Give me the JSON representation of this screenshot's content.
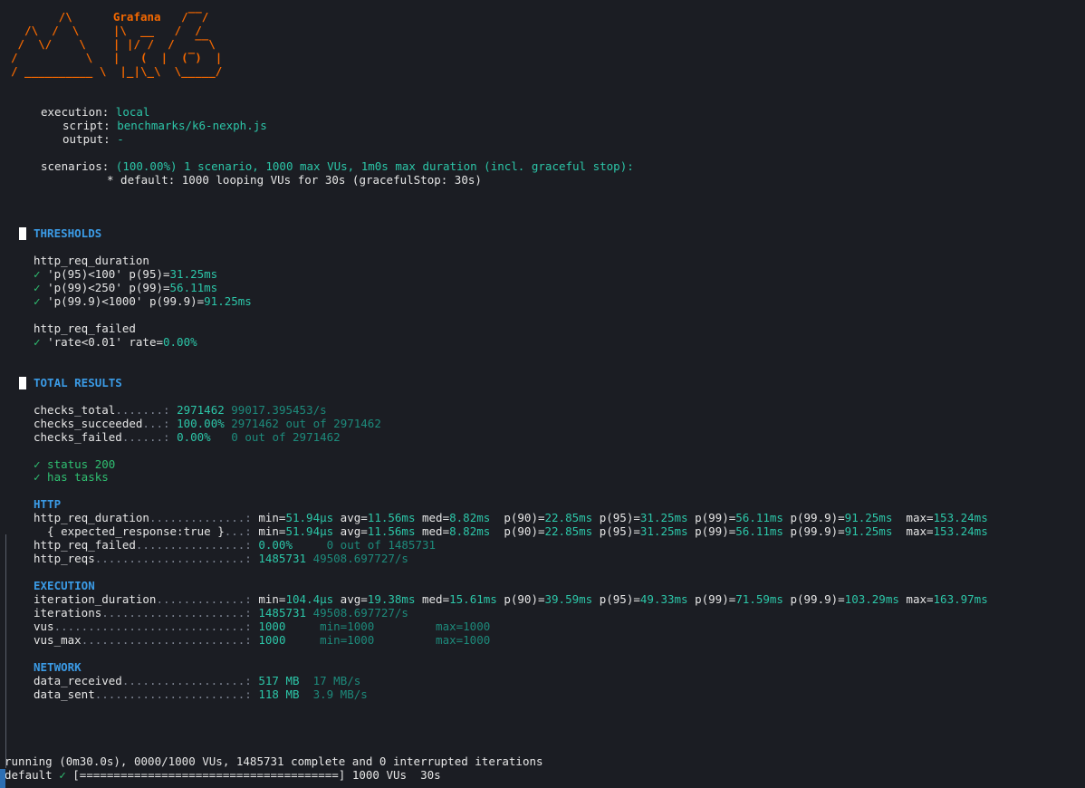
{
  "logo": {
    "lines": [
      "       /\\      Grafana   /‾‾/  ",
      "  /\\  /  \\     |\\  __   /  /   ",
      " /  \\/    \\    | |/ /  /   ‾‾\\ ",
      "/          \\   |   (  |  (‾)  |",
      "/ __________ \\  |_|\\_\\  \\_____/ "
    ]
  },
  "execution": {
    "execution_label": "execution:",
    "execution_value": "local",
    "script_label": "script:",
    "script_value": "benchmarks/k6-nexph.js",
    "output_label": "output:",
    "output_value": "-",
    "scenarios_label": "scenarios:",
    "scenarios_value": "(100.00%) 1 scenario, 1000 max VUs, 1m0s max duration (incl. graceful stop):",
    "scenario_default": "* default: 1000 looping VUs for 30s (gracefulStop: 30s)"
  },
  "thresholds": {
    "title": "THRESHOLDS",
    "groups": [
      {
        "metric": "http_req_duration",
        "items": [
          {
            "check": "✓",
            "rule": "'p(95)<100' p(95)=",
            "value": "31.25ms"
          },
          {
            "check": "✓",
            "rule": "'p(99)<250' p(99)=",
            "value": "56.11ms"
          },
          {
            "check": "✓",
            "rule": "'p(99.9)<1000' p(99.9)=",
            "value": "91.25ms"
          }
        ]
      },
      {
        "metric": "http_req_failed",
        "items": [
          {
            "check": "✓",
            "rule": "'rate<0.01' rate=",
            "value": "0.00%"
          }
        ]
      }
    ]
  },
  "results": {
    "title": "TOTAL RESULTS",
    "checks": [
      {
        "name": "checks_total",
        "dots": ".......:",
        "value": "2971462",
        "extra": "99017.395453/s"
      },
      {
        "name": "checks_succeeded",
        "dots": "...:",
        "value": "100.00%",
        "extra": "2971462 out of 2971462"
      },
      {
        "name": "checks_failed",
        "dots": "......:",
        "value": "0.00%",
        "extra": "  0 out of 2971462"
      }
    ],
    "check_items": [
      "✓ status 200",
      "✓ has tasks"
    ],
    "http_title": "HTTP",
    "execution_title": "EXECUTION",
    "network_title": "NETWORK",
    "trend_rows": [
      {
        "name": "http_req_duration",
        "dots": "..............:",
        "min": "51.94µs",
        "avg": "11.56ms",
        "med": "8.82ms ",
        "p90": "22.85ms",
        "p95": "31.25ms",
        "p99": "56.11ms",
        "p999": "91.25ms ",
        "max": "153.24ms"
      },
      {
        "name": "  { expected_response:true }",
        "dots": "...:",
        "min": "51.94µs",
        "avg": "11.56ms",
        "med": "8.82ms ",
        "p90": "22.85ms",
        "p95": "31.25ms",
        "p99": "56.11ms",
        "p999": "91.25ms ",
        "max": "153.24ms"
      },
      {
        "name": "iteration_duration",
        "dots": ".............:",
        "min": "104.4µs",
        "avg": "19.38ms",
        "med": "15.61ms",
        "p90": "39.59ms",
        "p95": "49.33ms",
        "p99": "71.59ms",
        "p999": "103.29ms",
        "max": "163.97ms"
      }
    ],
    "http_other": [
      {
        "name": "http_req_failed",
        "dots": "................:",
        "value": "0.00%  ",
        "extra": "  0 out of 1485731"
      },
      {
        "name": "http_reqs",
        "dots": "......................:",
        "value": "1485731",
        "extra": "49508.697727/s"
      }
    ],
    "exec_other": [
      {
        "name": "iterations",
        "dots": ".....................:",
        "value": "1485731",
        "extra": "49508.697727/s"
      },
      {
        "name": "vus",
        "dots": "............................:",
        "value": "1000   ",
        "extra": " min=1000         max=1000"
      },
      {
        "name": "vus_max",
        "dots": "........................:",
        "value": "1000   ",
        "extra": " min=1000         max=1000"
      }
    ],
    "network_rows": [
      {
        "name": "data_received",
        "dots": "..................:",
        "value": "517 MB ",
        "extra": "17 MB/s"
      },
      {
        "name": "data_sent",
        "dots": "......................:",
        "value": "118 MB ",
        "extra": "3.9 MB/s"
      }
    ]
  },
  "status": {
    "running": "running (0m30.0s), 0000/1000 VUs, 1485731 complete and 0 interrupted iterations",
    "default_label": "default",
    "default_check": "✓",
    "progress": "[======================================]",
    "progress_fraction": 1.0,
    "progress_tail": "1000 VUs  30s"
  },
  "colors": {
    "background": "#1b1d23",
    "logo": "#f46800",
    "value": "#2cc6a8",
    "dim_value": "#1d8a7b",
    "header": "#3b9be6",
    "check": "#2fbf71"
  }
}
